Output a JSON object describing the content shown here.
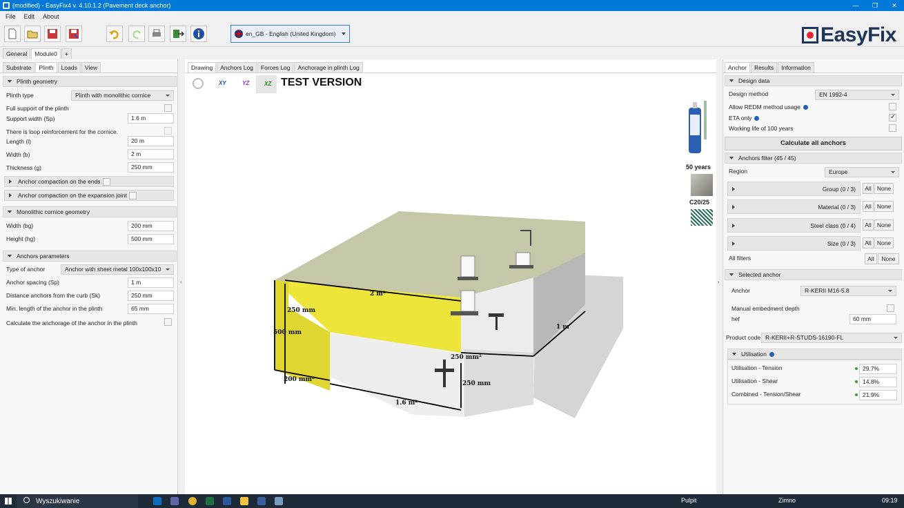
{
  "window": {
    "title": "(modified) - EasyFix4 v. 4.10.1.2 (Pavement deck anchor)"
  },
  "menu": [
    "File",
    "Edit",
    "About"
  ],
  "language": {
    "selected": "en_GB - English (United Kingdom)"
  },
  "brand": "EasyFix",
  "top_tabs": [
    "General",
    "Module0",
    "+"
  ],
  "left_tabs": [
    "Substrate",
    "Plinth",
    "Loads",
    "View"
  ],
  "plinth_geometry": {
    "title": "Plinth geometry",
    "plinth_type_label": "Plinth type",
    "plinth_type_value": "Plinth with monolithic cornice",
    "full_support_label": "Full support of the plinth",
    "support_width_label": "Support width (Sp)",
    "support_width_value": "1.6 m",
    "loop_label": "There is loop reinforcement for the cornice.",
    "length_label": "Length (l)",
    "length_value": "20 m",
    "width_label": "Width (b)",
    "width_value": "2 m",
    "thickness_label": "Thickness (g)",
    "thickness_value": "250 mm",
    "compaction_ends": "Anchor compaction on the ends",
    "compaction_joint": "Anchor compaction on the expansion joint"
  },
  "cornice": {
    "title": "Monolithic cornice geometry",
    "width_label": "Width (bg)",
    "width_value": "200 mm",
    "height_label": "Height (hg)",
    "height_value": "500 mm"
  },
  "anchors_params": {
    "title": "Anchors parameters",
    "type_label": "Type of anchor",
    "type_value": "Anchor with sheet metal 100x100x10",
    "spacing_label": "Anchor spacing (Sp)",
    "spacing_value": "1 m",
    "distance_label": "Distance anchors from the curb (Sk)",
    "distance_value": "250 mm",
    "minlen_label": "Min. length of the anchor in the plinth",
    "minlen_value": "65 mm",
    "calc_label": "Calculate the anchorage of the anchor in the plinth"
  },
  "center_tabs": [
    "Drawing",
    "Anchors Log",
    "Forces Log",
    "Anchorage in plinth Log"
  ],
  "view_buttons": [
    "XY",
    "YZ",
    "XZ"
  ],
  "test_version": "TEST VERSION",
  "side_info": {
    "years": "50 years",
    "concrete": "C20/25"
  },
  "dims": {
    "d2m": "2 m²",
    "d250a": "250 mm",
    "d500": "500 mm",
    "d1m": "1 m",
    "d250b": "250 mm²",
    "d250c": "250 mm",
    "d200": "200 mm²",
    "d16": "1.6 m²"
  },
  "right_tabs": [
    "Anchor",
    "Results",
    "Information"
  ],
  "design": {
    "title": "Design data",
    "method_label": "Design method",
    "method_value": "EN 1992-4",
    "redm_label": "Allow REDM method usage",
    "eta_label": "ETA only",
    "life_label": "Working life of 100 years",
    "calc_all": "Calculate all anchors"
  },
  "filter": {
    "title": "Anchors filter (45 / 45)",
    "region_label": "Region",
    "region_value": "Europe",
    "rows": [
      {
        "label": "Group (0 / 3)"
      },
      {
        "label": "Material (0 / 3)"
      },
      {
        "label": "Steel class (0 / 4)"
      },
      {
        "label": "Size (0 / 3)"
      }
    ],
    "all": "All",
    "none": "None",
    "all_filters": "All filters"
  },
  "selected": {
    "title": "Selected anchor",
    "anchor_label": "Anchor",
    "anchor_value": "R-KERII M16-5.8",
    "manual_label": "Manual embedment depth",
    "hef_label": "hef",
    "hef_value": "60 mm",
    "product_label": "Product code",
    "product_value": "R-KERII+R-STUDS-16190-FL"
  },
  "utilisation": {
    "title": "Utilisation",
    "rows": [
      {
        "label": "Utilisation - Tension",
        "value": "29.7%"
      },
      {
        "label": "Utilisation - Shear",
        "value": "14.8%"
      },
      {
        "label": "Combined - Tension/Shear",
        "value": "21.9%"
      }
    ]
  },
  "taskbar": {
    "search": "Wyszukiwanie",
    "pulpit": "Pulpit",
    "weather": "Zimno",
    "time": "09:19"
  }
}
